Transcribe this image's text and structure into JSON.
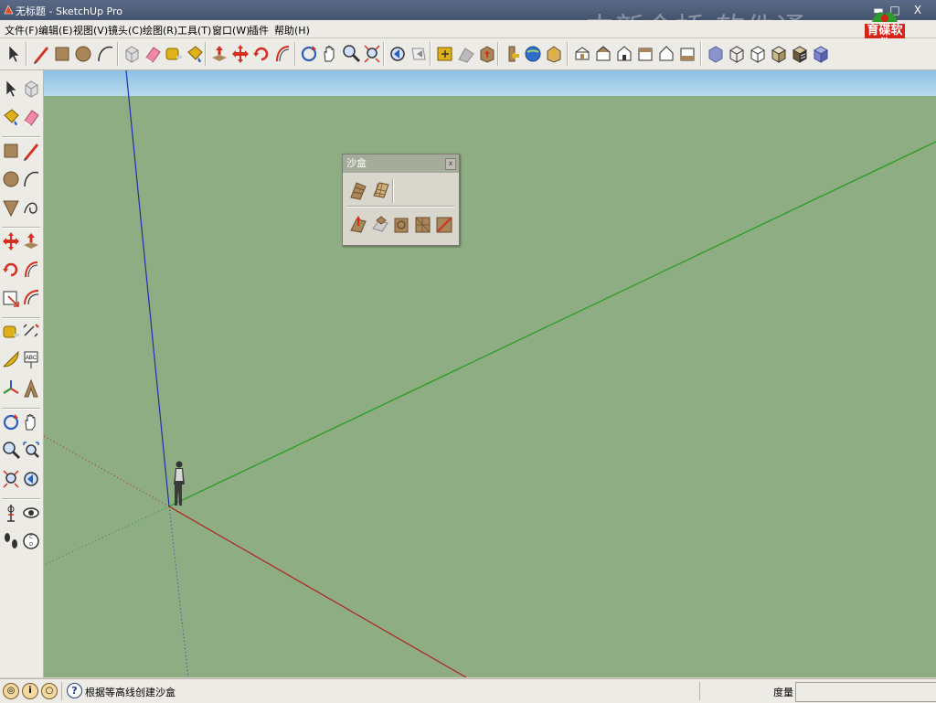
{
  "window": {
    "title": "无标题 - SketchUp Pro",
    "watermark": "中新金桥 软件通",
    "logo_text": "育碟软件",
    "min_label": "▬",
    "max_label": "□",
    "close_label": "X"
  },
  "menu": [
    "文件(F)",
    "编辑(E)",
    "视图(V)",
    "镜头(C)",
    "绘图(R)",
    "工具(T)",
    "窗口(W)",
    "插件",
    "帮助(H)"
  ],
  "toolbar_icons": [
    "select-icon",
    "pencil-icon",
    "rectangle-icon",
    "circle-icon",
    "arc-icon",
    "make-component-icon",
    "eraser-icon",
    "tape-measure-icon",
    "paint-bucket-icon",
    "push-pull-icon",
    "move-icon",
    "rotate-icon",
    "follow-me-icon",
    "orbit-icon",
    "pan-icon",
    "zoom-icon",
    "zoom-extents-icon",
    "previous-view-icon",
    "next-view-icon",
    "add-location-icon",
    "toggle-terrain-icon",
    "get-models-icon",
    "share-model-icon",
    "share-component-icon",
    "warehouse-icon",
    "iso-view-icon",
    "top-view-icon",
    "front-view-icon",
    "right-view-icon",
    "back-view-icon",
    "left-view-icon",
    "xray-icon",
    "wireframe-icon",
    "hidden-line-icon",
    "shaded-icon",
    "shaded-textures-icon",
    "monochrome-icon"
  ],
  "left_tools": [
    [
      "select-icon",
      "make-component-icon"
    ],
    [
      "paint-bucket-icon",
      "eraser-icon"
    ],
    [
      "rectangle-icon",
      "line-icon"
    ],
    [
      "circle-icon",
      "arc-icon"
    ],
    [
      "polygon-icon",
      "freehand-icon"
    ],
    [
      "move-icon",
      "push-pull-icon"
    ],
    [
      "rotate-icon",
      "follow-me-icon"
    ],
    [
      "scale-icon",
      "offset-icon"
    ],
    [
      "tape-measure-icon",
      "dimensions-icon"
    ],
    [
      "protractor-icon",
      "text-icon"
    ],
    [
      "axes-icon",
      "3d-text-icon"
    ],
    [
      "orbit-icon",
      "pan-icon"
    ],
    [
      "zoom-icon",
      "zoom-window-icon"
    ],
    [
      "zoom-extents-icon",
      "previous-icon"
    ],
    [
      "position-camera-icon",
      "look-around-icon"
    ],
    [
      "walk-icon",
      "section-plane-icon"
    ]
  ],
  "sandbox": {
    "title": "沙盒",
    "close": "x",
    "row1": [
      "from-contours-icon",
      "from-scratch-icon"
    ],
    "row2": [
      "smoove-icon",
      "stamp-icon",
      "drape-icon",
      "add-detail-icon",
      "flip-edge-icon"
    ]
  },
  "status": {
    "message": "根据等高线创建沙盒",
    "measure_label": "度量",
    "measure_value": "",
    "help": "?"
  },
  "colors": {
    "ground": "#8fad83",
    "sky": "#a7cfe8",
    "axis_red": "#b02020",
    "axis_green": "#1e9c1e",
    "axis_blue": "#2030b0"
  }
}
